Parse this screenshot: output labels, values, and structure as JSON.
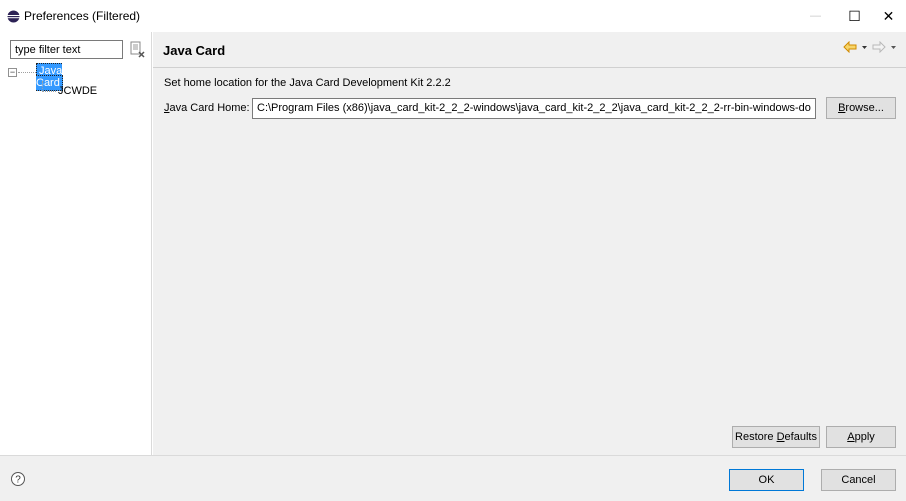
{
  "window": {
    "title": "Preferences (Filtered)",
    "min_glyph": "—",
    "max_glyph": "☐",
    "close_glyph": "✕"
  },
  "sidebar": {
    "filter_placeholder": "type filter text",
    "filter_value": "type filter text",
    "tree": {
      "root_label": "Java Card",
      "toggle": "−",
      "children": [
        "JCWDE"
      ]
    }
  },
  "page": {
    "title": "Java Card",
    "description": "Set home location for the Java Card Development Kit 2.2.2",
    "home_label_mnemonic": "J",
    "home_label_rest": "ava Card Home:",
    "home_value": "C:\\Program Files (x86)\\java_card_kit-2_2_2-windows\\java_card_kit-2_2_2\\java_card_kit-2_2_2-rr-bin-windows-do",
    "browse_mnemonic": "B",
    "browse_rest": "rowse...",
    "restore_pre": "Restore ",
    "restore_mnemonic": "D",
    "restore_post": "efaults",
    "apply_mnemonic": "A",
    "apply_rest": "pply"
  },
  "footer": {
    "ok_label": "OK",
    "cancel_label": "Cancel"
  },
  "colors": {
    "selection": "#3399ff",
    "nav_arrow": "#e8a400",
    "ok_border": "#0078d7"
  },
  "icons": {
    "app": "eclipse-icon",
    "clear_filter": "clear-filter-icon",
    "back": "back-arrow-icon",
    "forward": "forward-arrow-icon",
    "help": "help-icon"
  }
}
